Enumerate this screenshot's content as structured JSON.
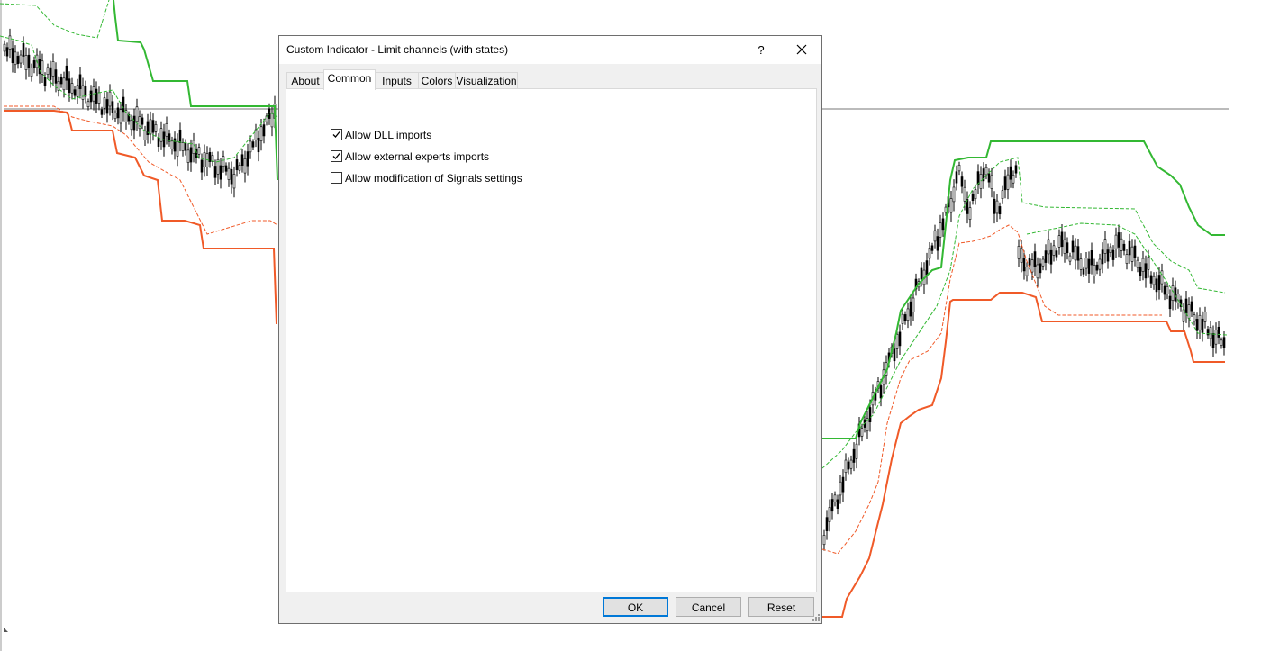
{
  "window": {
    "title": "Custom Indicator - Limit channels (with states)",
    "help_glyph": "?",
    "close_icon": "close-icon"
  },
  "tabs": [
    {
      "label": "About",
      "active": false
    },
    {
      "label": "Common",
      "active": true
    },
    {
      "label": "Inputs",
      "active": false
    },
    {
      "label": "Colors",
      "active": false
    },
    {
      "label": "Visualization",
      "active": false
    }
  ],
  "options": [
    {
      "label": "Allow DLL imports",
      "checked": true
    },
    {
      "label": "Allow external experts imports",
      "checked": true
    },
    {
      "label": "Allow modification of Signals settings",
      "checked": false
    }
  ],
  "buttons": {
    "ok": "OK",
    "cancel": "Cancel",
    "reset": "Reset"
  },
  "colors": {
    "upper_channel": "#33b833",
    "lower_channel": "#f05a28",
    "inner_upper": "#33b833",
    "inner_lower": "#f05a28",
    "candles": "#000000",
    "accent": "#0078d7"
  }
}
